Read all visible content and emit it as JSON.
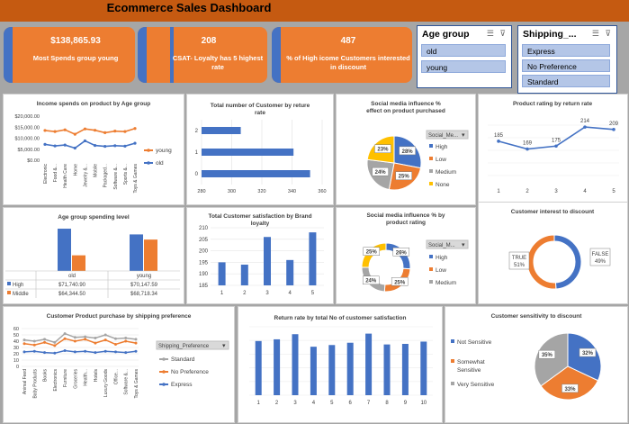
{
  "title": "Ecommerce Sales Dashboard",
  "kpis": [
    {
      "value": "$138,865.93",
      "label": "Most Spends group young"
    },
    {
      "value": "208",
      "label": "CSAT- Loyalty has 5 highest rate"
    },
    {
      "value": "487",
      "label": "% of High icome Customers interested in discount"
    }
  ],
  "slicers": [
    {
      "title": "Age group",
      "items": [
        "old",
        "young"
      ]
    },
    {
      "title": "Shipping_...",
      "items": [
        "Express",
        "No Preference",
        "Standard"
      ]
    }
  ],
  "colors": {
    "blue": "#4472c4",
    "orange": "#ed7d31",
    "gray": "#a5a5a5",
    "yellow": "#ffc000"
  },
  "chart_data": [
    {
      "id": "income_spends",
      "type": "line",
      "title": "Income spends on product by Age group",
      "categories": [
        "Electronic",
        "Food &...",
        "Health Care",
        "Home",
        "Jewelry &...",
        "Mobile",
        "Packaged...",
        "Software &...",
        "Sports &...",
        "Toys & Games"
      ],
      "series": [
        {
          "name": "young",
          "values": [
            13500,
            13000,
            13800,
            11800,
            14200,
            13600,
            12500,
            13200,
            13000,
            14400
          ]
        },
        {
          "name": "old",
          "values": [
            7200,
            6500,
            6900,
            5500,
            8800,
            6700,
            6300,
            6600,
            6400,
            7700
          ]
        }
      ],
      "yticks": [
        "$20,000.00",
        "$15,000.00",
        "$10,000.00",
        "$5,000.00",
        "$0.00"
      ],
      "ylim": [
        0,
        20000
      ],
      "legend": "right"
    },
    {
      "id": "customers_return_rate",
      "type": "bar",
      "orientation": "horizontal",
      "title": "Total number of Customer by reture rate",
      "categories": [
        "0",
        "1",
        "2"
      ],
      "values": [
        352,
        341,
        306
      ],
      "xlim": [
        280,
        360
      ],
      "xticks": [
        "280",
        "300",
        "320",
        "340",
        "360"
      ]
    },
    {
      "id": "social_influence_purchase",
      "type": "pie",
      "title": "Social media influence % effect on product purchased",
      "filter_label": "Social_Me...",
      "labels": [
        "High",
        "Low",
        "Medium",
        "None"
      ],
      "values": [
        28,
        25,
        24,
        23
      ],
      "value_labels": [
        "28%",
        "25%",
        "24%",
        "23%"
      ],
      "legend": "right"
    },
    {
      "id": "rating_return_rate",
      "type": "line",
      "title": "Product rating by return rate",
      "categories": [
        "1",
        "2",
        "3",
        "4",
        "5"
      ],
      "values": [
        185,
        169,
        175,
        214,
        209
      ],
      "ylim": [
        100,
        240
      ]
    },
    {
      "id": "age_spending_level",
      "type": "bar",
      "title": "Age group spending level",
      "categories": [
        "old",
        "young"
      ],
      "series": [
        {
          "name": "High",
          "values": [
            71740.9,
            70147.59
          ],
          "display": [
            "$71,740.90",
            "$70,147.59"
          ]
        },
        {
          "name": "Middle",
          "values": [
            64344.5,
            68718.34
          ],
          "display": [
            "$64,344.50",
            "$68,718.34"
          ]
        }
      ],
      "ylim": [
        60000,
        73000
      ],
      "legend": "table"
    },
    {
      "id": "satisfaction_loyalty",
      "type": "bar",
      "title": "Total Customer satisfaction by Brand loyalty",
      "categories": [
        "1",
        "2",
        "3",
        "4",
        "5"
      ],
      "values": [
        195,
        194,
        206,
        196,
        208
      ],
      "ylim": [
        185,
        210
      ],
      "yticks": [
        "210",
        "205",
        "200",
        "195",
        "190",
        "185"
      ]
    },
    {
      "id": "social_influence_rating",
      "type": "pie",
      "donut": true,
      "title": "Social media influence % by product rating",
      "filter_label": "Social_M...",
      "labels": [
        "High",
        "Low",
        "Medium"
      ],
      "values": [
        26,
        25,
        24,
        25
      ],
      "value_labels": [
        "26%",
        "25%",
        "24%",
        "25%"
      ],
      "slice_colors": [
        "#4472c4",
        "#ed7d31",
        "#a5a5a5",
        "#ffc000"
      ],
      "legend": "right"
    },
    {
      "id": "interest_discount",
      "type": "pie",
      "donut": true,
      "title": "Customer interest to discount",
      "labels": [
        "FALSE",
        "TRUE"
      ],
      "values": [
        49,
        51
      ],
      "value_labels": [
        "FALSE\n49%",
        "TRUE\n51%"
      ]
    },
    {
      "id": "purchase_shipping",
      "type": "line",
      "title": "Customer Product purchase by shipping preference",
      "filter_label": "Shipping_Preference",
      "categories": [
        "Animal Feed",
        "Baby Products",
        "Books",
        "Electronics",
        "Furniture",
        "Groceries",
        "Health...",
        "Hotels",
        "Luxury Goods",
        "Office...",
        "Software &...",
        "Toys & Games"
      ],
      "series": [
        {
          "name": "Standard",
          "values": [
            42,
            40,
            43,
            38,
            52,
            46,
            47,
            45,
            50,
            44,
            45,
            43
          ]
        },
        {
          "name": "No Preference",
          "values": [
            36,
            34,
            38,
            33,
            44,
            40,
            43,
            37,
            42,
            35,
            40,
            37
          ]
        },
        {
          "name": "Express",
          "values": [
            23,
            24,
            22,
            21,
            25,
            23,
            24,
            22,
            24,
            23,
            22,
            24
          ]
        }
      ],
      "ylim": [
        0,
        60
      ],
      "yticks": [
        "60",
        "50",
        "40",
        "30",
        "20",
        "10",
        "0"
      ],
      "legend": "right"
    },
    {
      "id": "return_by_satisfaction",
      "type": "bar",
      "title": "Return rate by total No of customer satisfaction",
      "categories": [
        "1",
        "2",
        "3",
        "4",
        "5",
        "6",
        "7",
        "8",
        "9",
        "10"
      ],
      "values": [
        95,
        98,
        107,
        85,
        88,
        92,
        108,
        89,
        90,
        94
      ],
      "ylim": [
        0,
        120
      ]
    },
    {
      "id": "sensitivity_discount",
      "type": "pie",
      "title": "Customer sensitivity to discount",
      "labels": [
        "Not Sensitive",
        "Somewhat Sensitive",
        "Very Sensitive"
      ],
      "values": [
        32,
        33,
        35
      ],
      "value_labels": [
        "32%",
        "33%",
        "35%"
      ],
      "legend": "left"
    }
  ]
}
